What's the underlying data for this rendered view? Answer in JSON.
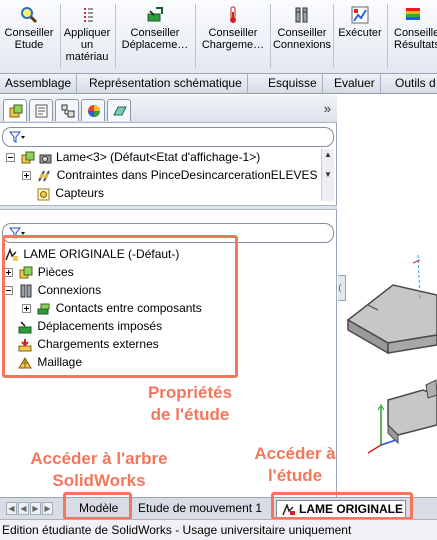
{
  "ribbon": {
    "buttons": [
      {
        "label": "Conseiller\nEtude",
        "icon": "magnifier-icon"
      },
      {
        "label": "Appliquer\nun\nmatériau",
        "icon": "material-icon"
      },
      {
        "label": "Conseiller\nDéplaceme…",
        "icon": "fixture-icon"
      },
      {
        "label": "Conseiller\nChargeme…",
        "icon": "load-icon"
      },
      {
        "label": "Conseiller\nConnexions",
        "icon": "connector-icon"
      },
      {
        "label": "Exécuter",
        "icon": "run-icon"
      },
      {
        "label": "Conseiller\nRésultats",
        "icon": "results-icon"
      }
    ]
  },
  "tabs": [
    "Assemblage",
    "Représentation schématique",
    "Esquisse",
    "Evaluer",
    "Outils d"
  ],
  "panel": {
    "collapse_label": "»",
    "feature_tree": [
      {
        "label": "Lame<3> (Défaut<Etat d'affichage-1>)"
      },
      {
        "label": "Contraintes dans PinceDesincarcerationELEVES"
      },
      {
        "label": "Capteurs"
      }
    ],
    "study_tree": {
      "root": "LAME ORIGINALE (-Défaut-)",
      "items": [
        {
          "label": "Pièces"
        },
        {
          "label": "Connexions"
        },
        {
          "label": "Contacts entre composants"
        },
        {
          "label": "Déplacements imposés"
        },
        {
          "label": "Chargements externes"
        },
        {
          "label": "Maillage"
        }
      ]
    }
  },
  "annotations": {
    "study_properties": "Propriétés\nde l'étude",
    "access_tree": "Accéder à l'arbre\nSolidWorks",
    "access_study": "Accéder à\nl'étude"
  },
  "bottom_tabs": {
    "model": "Modèle",
    "motion": "Etude de mouvement 1",
    "study": "LAME ORIGINALE"
  },
  "status_bar": "Edition étudiante de SolidWorks - Usage universitaire uniquement",
  "colors": {
    "annotation": "#f4765c",
    "ribbon_bg": "#e3e8f0"
  }
}
